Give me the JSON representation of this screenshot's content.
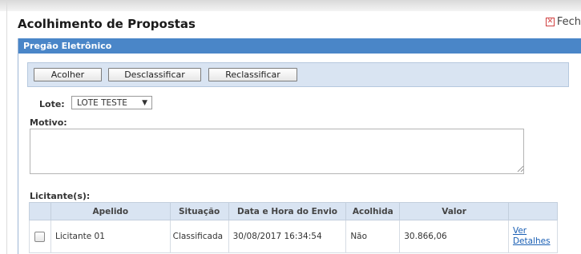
{
  "window": {
    "title": "Acolhimento de Propostas",
    "close_label": "Fech"
  },
  "panel": {
    "header": "Pregão Eletrônico"
  },
  "toolbar": {
    "acolher_label": "Acolher",
    "desclassificar_label": "Desclassificar",
    "reclassificar_label": "Reclassificar"
  },
  "form": {
    "lote_label": "Lote:",
    "lote_value": "LOTE TESTE",
    "motivo_label": "Motivo:",
    "motivo_value": ""
  },
  "licitantes": {
    "label": "Licitante(s):",
    "columns": [
      "",
      "Apelido",
      "Situação",
      "Data e Hora do Envio",
      "Acolhida",
      "Valor",
      ""
    ],
    "rows": [
      {
        "apelido": "Licitante 01",
        "situacao": "Classificada",
        "data_hora": "30/08/2017 16:34:54",
        "acolhida": "Não",
        "valor": "30.866,06",
        "link_line1": "Ver",
        "link_line2": "Detalhes"
      }
    ]
  },
  "colors": {
    "panel_header": "#4a86c8",
    "toolbar_bg": "#d9e4f2",
    "link": "#1a5fb4",
    "close_icon": "#d04040"
  }
}
